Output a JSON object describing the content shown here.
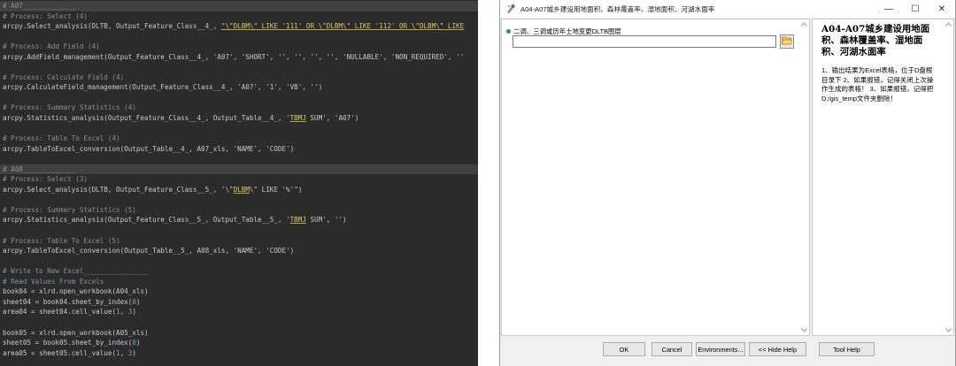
{
  "editor": {
    "lines": [
      {
        "hl": true,
        "parts": [
          {
            "t": "# A07_____________",
            "c": "comment"
          }
        ]
      },
      {
        "parts": [
          {
            "t": "# Process: Select (4)",
            "c": "comment"
          }
        ]
      },
      {
        "parts": [
          {
            "t": "arcpy.Select_analysis(DLTB, Output_Feature_Class__4_, "
          },
          {
            "t": "\"\\\"DLBM\\\" LIKE '111' OR \\\"DLBM\\\" LIKE '112' OR \\\"DLBM\\\" LIKE",
            "c": "ul"
          }
        ]
      },
      {
        "parts": [
          {
            "t": ""
          }
        ]
      },
      {
        "parts": [
          {
            "t": "# Process: Add Field (4)",
            "c": "comment"
          }
        ]
      },
      {
        "parts": [
          {
            "t": "arcpy.AddField_management(Output_Feature_Class__4_, 'A07', 'SHORT', '', '', '', '', 'NULLABLE', 'NON_REQUIRED', ''"
          }
        ]
      },
      {
        "parts": [
          {
            "t": ""
          }
        ]
      },
      {
        "parts": [
          {
            "t": "# Process: Calculate Field (4)",
            "c": "comment"
          }
        ]
      },
      {
        "parts": [
          {
            "t": "arcpy.CalculateField_management(Output_Feature_Class__4_, 'A07', '1', 'VB', '')"
          }
        ]
      },
      {
        "parts": [
          {
            "t": ""
          }
        ]
      },
      {
        "parts": [
          {
            "t": "# Process: Summary Statistics (4)",
            "c": "comment"
          }
        ]
      },
      {
        "parts": [
          {
            "t": "arcpy.Statistics_analysis(Output_Feature_Class__4_, Output_Table__4_, '"
          },
          {
            "t": "TBMJ",
            "c": "ul"
          },
          {
            "t": " SUM', 'A07')"
          }
        ]
      },
      {
        "parts": [
          {
            "t": ""
          }
        ]
      },
      {
        "parts": [
          {
            "t": "# Process: Table To Excel (4)",
            "c": "comment"
          }
        ]
      },
      {
        "parts": [
          {
            "t": "arcpy.TableToExcel_conversion(Output_Table__4_, A07_xls, 'NAME', 'CODE')"
          }
        ]
      },
      {
        "parts": [
          {
            "t": ""
          }
        ]
      },
      {
        "hl": true,
        "parts": [
          {
            "t": "# A08_____________",
            "c": "comment"
          }
        ]
      },
      {
        "parts": [
          {
            "t": "# Process: Select (3)",
            "c": "comment"
          }
        ]
      },
      {
        "parts": [
          {
            "t": "arcpy.Select_analysis(DLTB, Output_Feature_Class__5_, '\\\""
          },
          {
            "t": "DLBM",
            "c": "ul"
          },
          {
            "t": "\\\" LIKE '%'\")"
          }
        ]
      },
      {
        "parts": [
          {
            "t": ""
          }
        ]
      },
      {
        "parts": [
          {
            "t": "# Process: Summary Statistics (5)",
            "c": "comment"
          }
        ]
      },
      {
        "parts": [
          {
            "t": "arcpy.Statistics_analysis(Output_Feature_Class__5_, Output_Table__5_, '"
          },
          {
            "t": "TBMJ",
            "c": "ul"
          },
          {
            "t": " SUM', '')"
          }
        ]
      },
      {
        "parts": [
          {
            "t": ""
          }
        ]
      },
      {
        "parts": [
          {
            "t": "# Process: Table To Excel (5)",
            "c": "comment"
          }
        ]
      },
      {
        "parts": [
          {
            "t": "arcpy.TableToExcel_conversion(Output_Table__5_, A08_xls, 'NAME', 'CODE')"
          }
        ]
      },
      {
        "parts": [
          {
            "t": ""
          }
        ]
      },
      {
        "parts": [
          {
            "t": "# Write to New Excel________________",
            "c": "comment"
          }
        ]
      },
      {
        "parts": [
          {
            "t": "# Read Values From Excels",
            "c": "comment"
          }
        ]
      },
      {
        "parts": [
          {
            "t": "book04 = xlrd.open_workbook(A04_xls)"
          }
        ]
      },
      {
        "parts": [
          {
            "t": "sheet04 = book04.sheet_by_index("
          },
          {
            "t": "0",
            "c": "num"
          },
          {
            "t": ")"
          }
        ]
      },
      {
        "parts": [
          {
            "t": "area04 = sheet04.cell_value("
          },
          {
            "t": "1",
            "c": "num"
          },
          {
            "t": ", "
          },
          {
            "t": "3",
            "c": "num"
          },
          {
            "t": ")"
          }
        ]
      },
      {
        "parts": [
          {
            "t": ""
          }
        ]
      },
      {
        "parts": [
          {
            "t": "book05 = xlrd.open_workbook(A05_xls)"
          }
        ]
      },
      {
        "parts": [
          {
            "t": "sheet05 = book05.sheet_by_index("
          },
          {
            "t": "0",
            "c": "num"
          },
          {
            "t": ")"
          }
        ]
      },
      {
        "parts": [
          {
            "t": "area05 = sheet05.cell_value("
          },
          {
            "t": "1",
            "c": "num"
          },
          {
            "t": ", "
          },
          {
            "t": "3",
            "c": "num"
          },
          {
            "t": ")"
          }
        ]
      }
    ]
  },
  "dialog": {
    "title": "A04-A07城乡建设用地面积、森林覆盖率、湿地面积、河湖水面率",
    "minimize": "—",
    "maximize": "☐",
    "close": "✕",
    "param_label": "二调、三调或历年土地变更DLTB图层",
    "param_value": "",
    "help_title": "A04-A07城乡建设用地面积、森林覆盖率、湿地面积、河湖水面率",
    "help_body": "1、输出结果为Excel表格，位于D盘根目录下 2、如果报错，记得关闭上次操作生成的表格！ 3、如果报错，记得把D:/gis_temp文件夹删除！",
    "buttons": {
      "ok": "OK",
      "cancel": "Cancel",
      "environments": "Environments...",
      "hide_help": "<< Hide Help",
      "tool_help": "Tool Help"
    }
  },
  "colors": {
    "editor_bg": "#2b2b2b",
    "comment": "#8a8f93",
    "folder": "#e8b04a"
  }
}
